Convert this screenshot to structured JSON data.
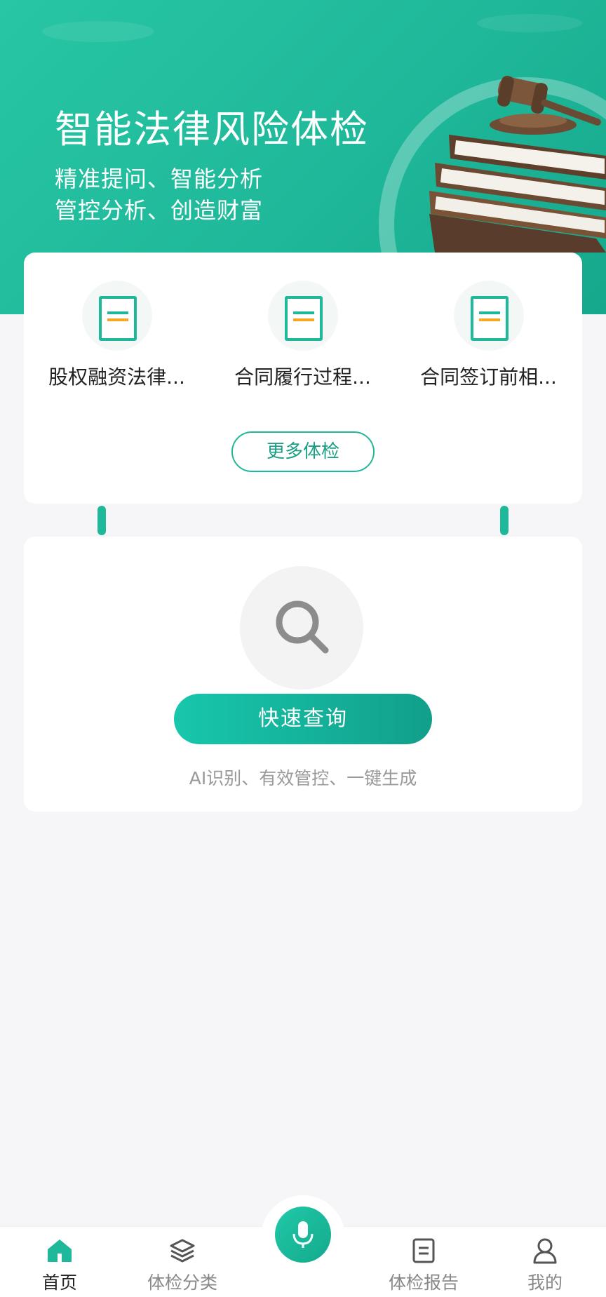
{
  "hero": {
    "title": "智能法律风险体检",
    "subtitle_line1": "精准提问、智能分析",
    "subtitle_line2": "管控分析、创造财富"
  },
  "checkups": {
    "items": [
      {
        "label": "股权融资法律...",
        "icon": "document-icon"
      },
      {
        "label": "合同履行过程...",
        "icon": "document-icon"
      },
      {
        "label": "合同签订前相...",
        "icon": "document-icon"
      }
    ],
    "more_button": "更多体检"
  },
  "quick_query": {
    "icon": "search-icon",
    "button": "快速查询",
    "tagline": "AI识别、有效管控、一键生成"
  },
  "tabbar": {
    "items": [
      {
        "label": "首页",
        "icon": "home-icon",
        "active": true
      },
      {
        "label": "体检分类",
        "icon": "layers-icon",
        "active": false
      },
      {
        "label": "体检报告",
        "icon": "report-icon",
        "active": false
      },
      {
        "label": "我的",
        "icon": "user-icon",
        "active": false
      }
    ],
    "center": {
      "icon": "microphone-icon"
    }
  },
  "colors": {
    "accent": "#1fb89a",
    "secondary_accent": "#f5a623",
    "background": "#f6f6f8"
  }
}
